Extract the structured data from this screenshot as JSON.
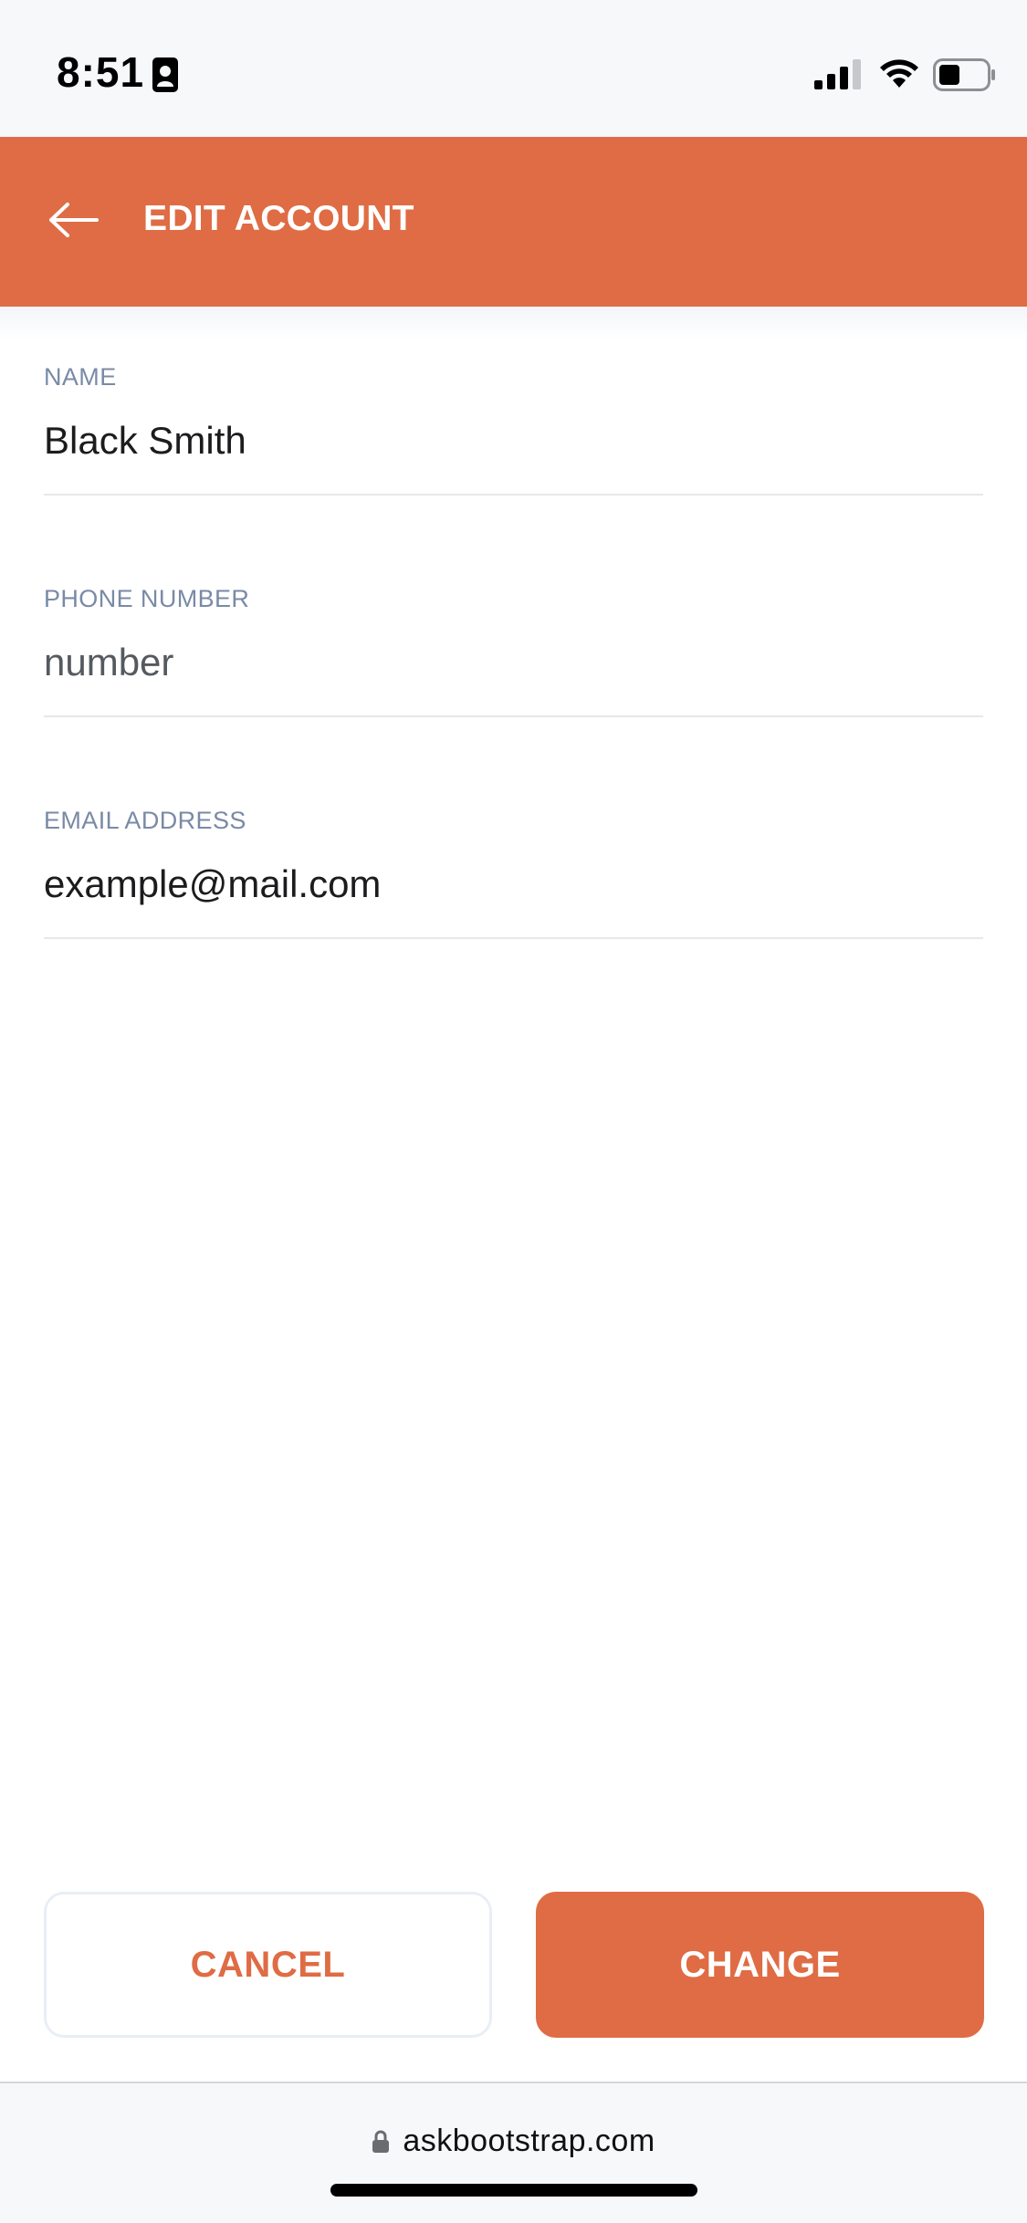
{
  "status_bar": {
    "time": "8:51",
    "icons": [
      "contact-card-icon",
      "cellular-signal-icon",
      "wifi-icon",
      "battery-icon"
    ]
  },
  "header": {
    "title": "EDIT ACCOUNT",
    "back_icon": "arrow-left-icon",
    "background_color": "#df6c44"
  },
  "form": {
    "name": {
      "label": "NAME",
      "value": "Black Smith",
      "placeholder": ""
    },
    "phone": {
      "label": "PHONE NUMBER",
      "value": "",
      "placeholder": "number"
    },
    "email": {
      "label": "EMAIL ADDRESS",
      "value": "example@mail.com",
      "placeholder": ""
    }
  },
  "actions": {
    "cancel_label": "CANCEL",
    "change_label": "CHANGE"
  },
  "browser": {
    "url": "askbootstrap.com",
    "lock_icon": "lock-icon"
  },
  "colors": {
    "accent": "#df6c44",
    "label": "#7a8aa6",
    "text": "#1c1c1e"
  }
}
